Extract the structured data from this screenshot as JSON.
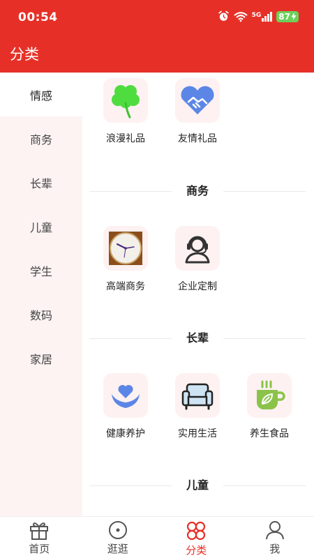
{
  "status": {
    "time": "00:54",
    "network": "5G",
    "battery": "87"
  },
  "header": {
    "title": "分类"
  },
  "colors": {
    "brand": "#e63027",
    "sidebar_bg": "#fdf3f3",
    "tile_bg": "#fdf1f1",
    "clover": "#4fdc3f",
    "blue_icon": "#5c86e6"
  },
  "sidebar": {
    "items": [
      {
        "label": "情感"
      },
      {
        "label": "商务"
      },
      {
        "label": "长辈"
      },
      {
        "label": "儿童"
      },
      {
        "label": "学生"
      },
      {
        "label": "数码"
      },
      {
        "label": "家居"
      }
    ],
    "active": "情感"
  },
  "content": {
    "sections": [
      {
        "title": "",
        "items": [
          {
            "label": "浪漫礼品",
            "icon": "clover-icon"
          },
          {
            "label": "友情礼品",
            "icon": "handshake-icon"
          }
        ]
      },
      {
        "title": "商务",
        "items": [
          {
            "label": "高端商务",
            "icon": "clock-icon"
          },
          {
            "label": "企业定制",
            "icon": "headset-agent-icon"
          }
        ]
      },
      {
        "title": "长辈",
        "items": [
          {
            "label": "健康养护",
            "icon": "heart-hands-icon"
          },
          {
            "label": "实用生活",
            "icon": "sofa-icon"
          },
          {
            "label": "养生食品",
            "icon": "tea-cup-icon"
          }
        ]
      },
      {
        "title": "儿童",
        "items": []
      }
    ]
  },
  "tabbar": {
    "tabs": [
      {
        "label": "首页",
        "icon": "gift-icon"
      },
      {
        "label": "逛逛",
        "icon": "compass-icon"
      },
      {
        "label": "分类",
        "icon": "category-icon"
      },
      {
        "label": "我",
        "icon": "user-icon"
      }
    ],
    "active": "分类"
  }
}
